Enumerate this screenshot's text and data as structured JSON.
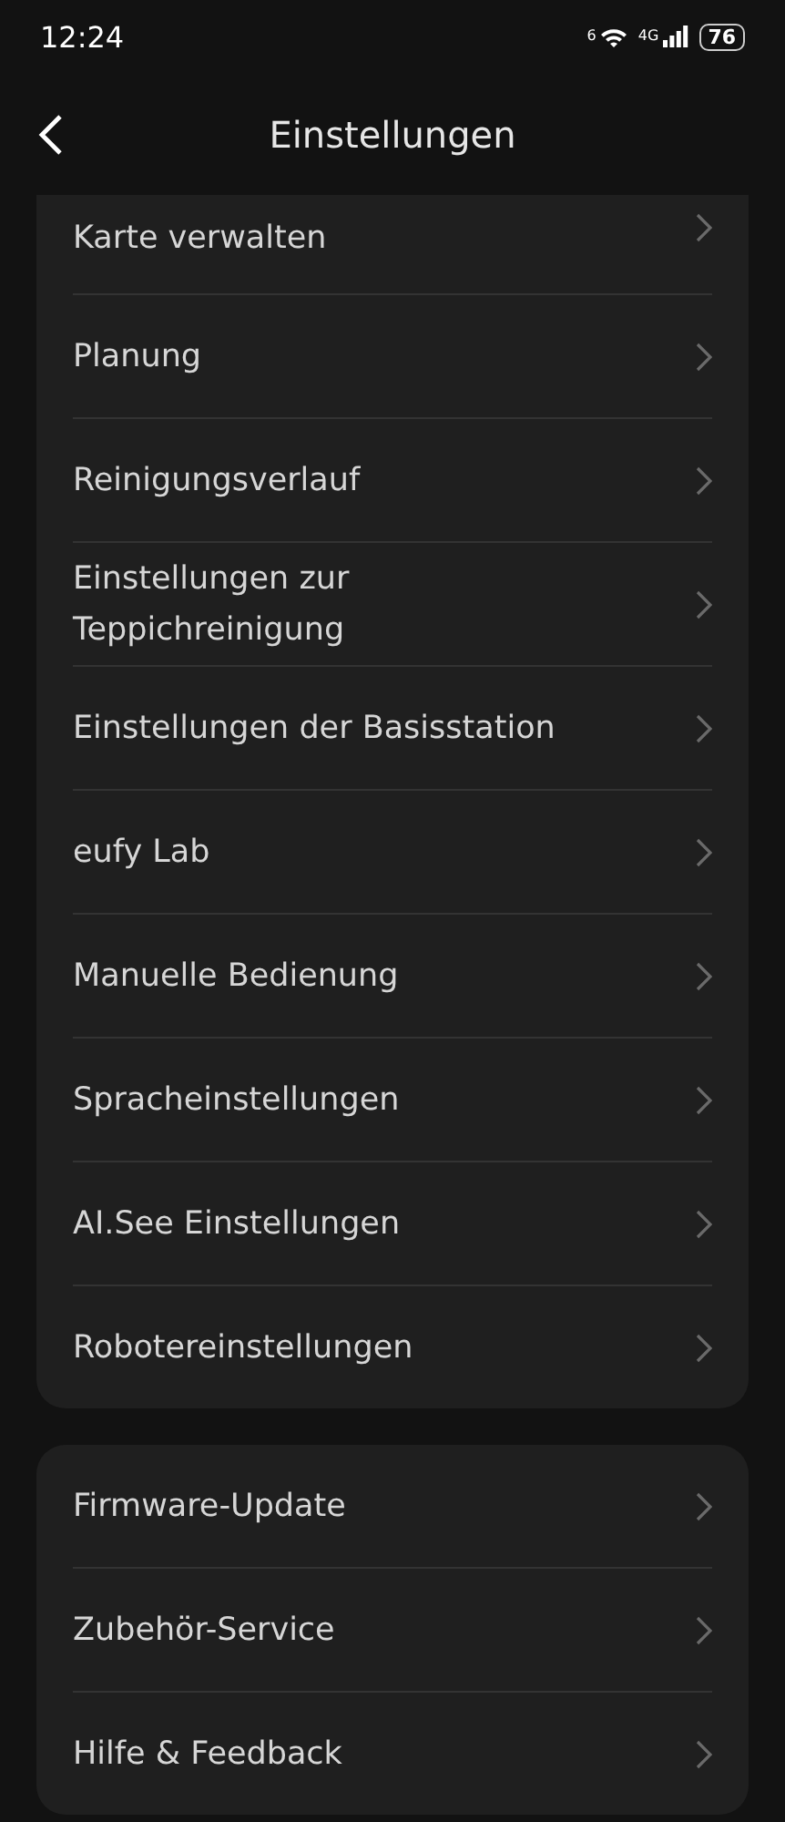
{
  "status_bar": {
    "time": "12:24",
    "wifi_badge": "6",
    "network": "4G",
    "battery": "76"
  },
  "header": {
    "title": "Einstellungen"
  },
  "groups": [
    {
      "cut_top": true,
      "items": [
        {
          "label": "Karte verwalten"
        },
        {
          "label": "Planung"
        },
        {
          "label": "Reinigungsverlauf"
        },
        {
          "label": "Einstellungen zur Teppichreinigung"
        },
        {
          "label": "Einstellungen der Basisstation"
        },
        {
          "label": "eufy Lab"
        },
        {
          "label": "Manuelle Bedienung"
        },
        {
          "label": "Spracheinstellungen"
        },
        {
          "label": "AI.See Einstellungen"
        },
        {
          "label": "Robotereinstellungen"
        }
      ]
    },
    {
      "cut_top": false,
      "items": [
        {
          "label": "Firmware-Update"
        },
        {
          "label": "Zubehör-Service"
        },
        {
          "label": "Hilfe & Feedback"
        }
      ]
    }
  ]
}
